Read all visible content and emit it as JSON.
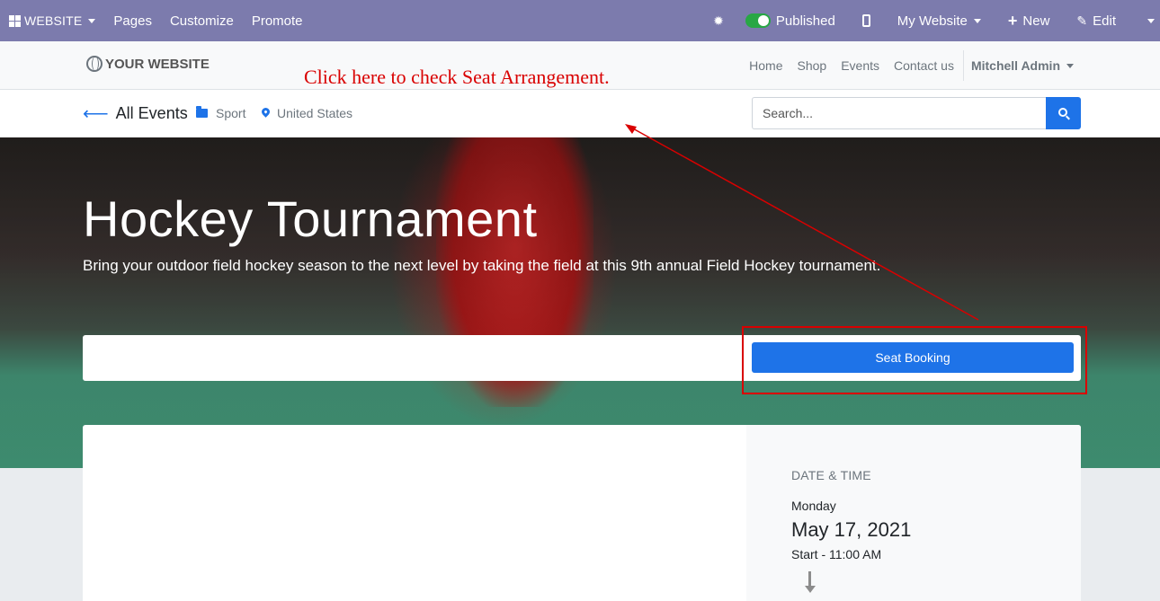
{
  "admin_bar": {
    "brand": "WEBSITE",
    "menu": [
      "Pages",
      "Customize",
      "Promote"
    ],
    "published_label": "Published",
    "website_selector": "My Website",
    "new_label": "New",
    "edit_label": "Edit",
    "color": "#7c7bad"
  },
  "header": {
    "logo": "YOUR WEBSITE",
    "nav": [
      "Home",
      "Shop",
      "Events",
      "Contact us"
    ],
    "user": "Mitchell Admin"
  },
  "annotation": {
    "text": "Click here to check Seat Arrangement.",
    "color": "#d90000"
  },
  "subnav": {
    "back_label": "All Events",
    "category": "Sport",
    "location": "United States",
    "search_placeholder": "Search..."
  },
  "event": {
    "title": "Hockey Tournament",
    "subtitle": "Bring your outdoor field hockey season to the next level by taking the field at this 9th annual Field Hockey tournament.",
    "seat_button": "Seat Booking",
    "date_heading": "DATE & TIME",
    "day": "Monday",
    "date": "May 17, 2021",
    "start": "Start - 11:00 AM"
  },
  "accent_color": "#1e73e8"
}
